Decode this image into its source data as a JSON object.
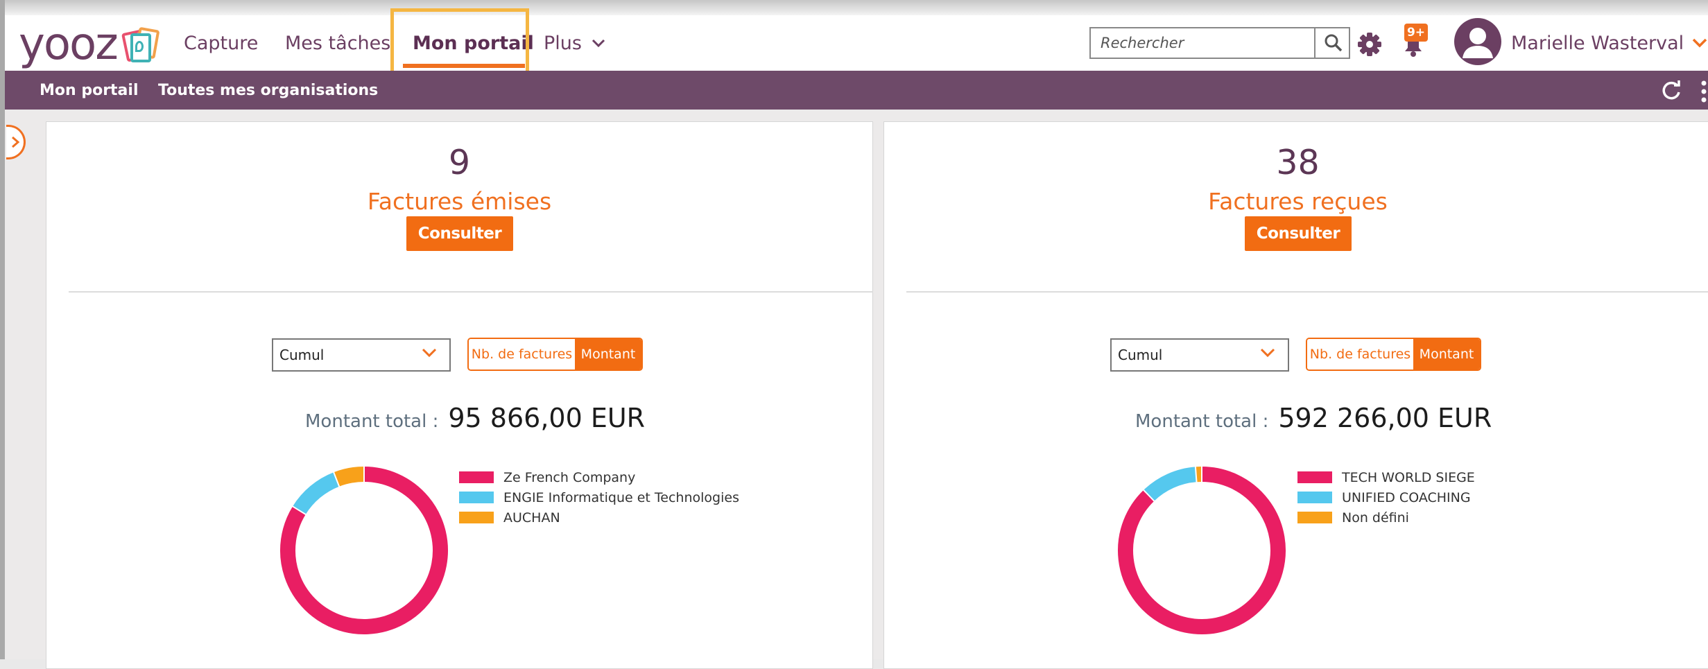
{
  "app": {
    "logo_text": "yooz"
  },
  "nav": {
    "capture": "Capture",
    "taches": "Mes tâches",
    "portail": "Mon portail",
    "plus": "Plus"
  },
  "search": {
    "placeholder": "Rechercher"
  },
  "notifications": {
    "badge": "9+"
  },
  "user": {
    "name": "Marielle Wasterval"
  },
  "subnav": {
    "portail": "Mon portail",
    "orgs": "Toutes mes organisations"
  },
  "colors": {
    "accent": "#f07020",
    "brand": "#6b3f62",
    "subnav": "#6e4a69"
  },
  "panels": [
    {
      "count": "9",
      "title": "Factures émises",
      "button": "Consulter",
      "select_value": "Cumul",
      "toggle": {
        "nb": "Nb. de factures",
        "montant": "Montant",
        "active": "Montant"
      },
      "total_label": "Montant total :",
      "total_value": "95 866,00 EUR",
      "legend": [
        {
          "label": "Ze French Company",
          "color": "#e91e63"
        },
        {
          "label": "ENGIE Informatique et Technologies",
          "color": "#55c8ee"
        },
        {
          "label": "AUCHAN",
          "color": "#f8a11a"
        }
      ]
    },
    {
      "count": "38",
      "title": "Factures reçues",
      "button": "Consulter",
      "select_value": "Cumul",
      "toggle": {
        "nb": "Nb. de factures",
        "montant": "Montant",
        "active": "Montant"
      },
      "total_label": "Montant total :",
      "total_value": "592 266,00 EUR",
      "legend": [
        {
          "label": "TECH WORLD SIEGE",
          "color": "#e91e63"
        },
        {
          "label": "UNIFIED COACHING",
          "color": "#55c8ee"
        },
        {
          "label": "Non défini",
          "color": "#f8a11a"
        }
      ]
    }
  ],
  "chart_data": [
    {
      "type": "pie",
      "labels": [
        "Ze French Company",
        "ENGIE Informatique et Technologies",
        "AUCHAN"
      ],
      "values": [
        0.838,
        0.103,
        0.059
      ],
      "colors": [
        "#e91e63",
        "#55c8ee",
        "#f8a11a"
      ],
      "legend_position": "right"
    },
    {
      "type": "pie",
      "labels": [
        "TECH WORLD SIEGE",
        "UNIFIED COACHING",
        "Non défini"
      ],
      "values": [
        0.878,
        0.11,
        0.012
      ],
      "colors": [
        "#e91e63",
        "#55c8ee",
        "#f8a11a"
      ],
      "legend_position": "right"
    }
  ]
}
